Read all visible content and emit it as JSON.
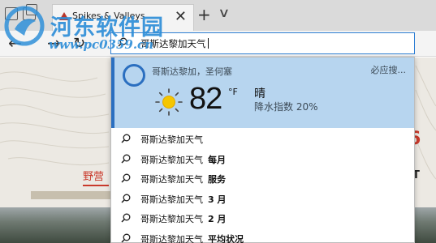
{
  "tab": {
    "title": "Spikes & Valleys",
    "close_glyph": "✕",
    "new_tab_glyph": "+",
    "tab_list_glyph": "∨"
  },
  "nav": {
    "back_glyph": "←",
    "forward_glyph": "→",
    "refresh_glyph": "↻"
  },
  "address": {
    "query": "哥斯达黎加天气"
  },
  "weather": {
    "location": "哥斯达黎加，圣何塞",
    "source": "必应搜...",
    "temperature": "82",
    "unit": "°F",
    "condition": "晴",
    "precipitation": "降水指数  20%"
  },
  "suggestions": [
    {
      "text": "哥斯达黎加天气",
      "suffix": ""
    },
    {
      "text": "哥斯达黎加天气",
      "suffix": "每月"
    },
    {
      "text": "哥斯达黎加天气",
      "suffix": "服务"
    },
    {
      "text": "哥斯达黎加天气",
      "suffix": "3 月"
    },
    {
      "text": "哥斯达黎加天气",
      "suffix": "2 月"
    },
    {
      "text": "哥斯达黎加天气",
      "suffix": "平均状况"
    }
  ],
  "page": {
    "left_label": "野营",
    "right_mark": "T",
    "red_mark": "6"
  },
  "watermark": {
    "title": "河东软件园",
    "url": "www.pc0359.cn"
  },
  "colors": {
    "accent": "#2b6fc0",
    "weather_bg": "#b7d5ef",
    "watermark": "#2f8fd8",
    "page_red": "#c9392b"
  },
  "icons": [
    "restore-window-icon",
    "warning-favicon-icon",
    "close-icon",
    "plus-icon",
    "chevron-down-icon",
    "back-arrow-icon",
    "forward-arrow-icon",
    "refresh-icon",
    "search-icon",
    "cortana-ring-icon",
    "sun-icon"
  ]
}
